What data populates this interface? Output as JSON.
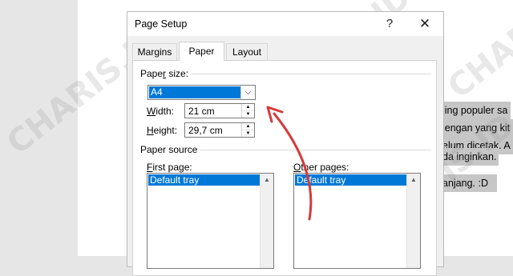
{
  "dialog": {
    "title": "Page Setup",
    "help": "?",
    "close": "✕"
  },
  "tabs": [
    {
      "label": "Margins",
      "selected": false
    },
    {
      "label": "Paper",
      "selected": true
    },
    {
      "label": "Layout",
      "selected": false
    }
  ],
  "paper_size": {
    "group_label_pre": "Pape",
    "group_label_key": "r",
    "group_label_post": " size:",
    "selected": "A4",
    "width_label_key": "W",
    "width_label_post": "idth:",
    "width_value": "21 cm",
    "height_label_key": "H",
    "height_label_post": "eight:",
    "height_value": "29,7 cm"
  },
  "paper_source": {
    "group_label": "Paper source",
    "first_page_label_key": "F",
    "first_page_label_post": "irst page:",
    "first_page_selected": "Default tray",
    "other_pages_label_key": "O",
    "other_pages_label_post": "ther pages:",
    "other_pages_selected": "Default tray"
  },
  "document_lines": [
    "ling populer sa",
    "lengan yang kit",
    "elum dicetak. A",
    "da inginkan.",
    "anjang. :D"
  ],
  "watermark": "CHARIS.ID",
  "colors": {
    "selection": "#0078d7",
    "annotation_arrow": "#d63a3a"
  }
}
